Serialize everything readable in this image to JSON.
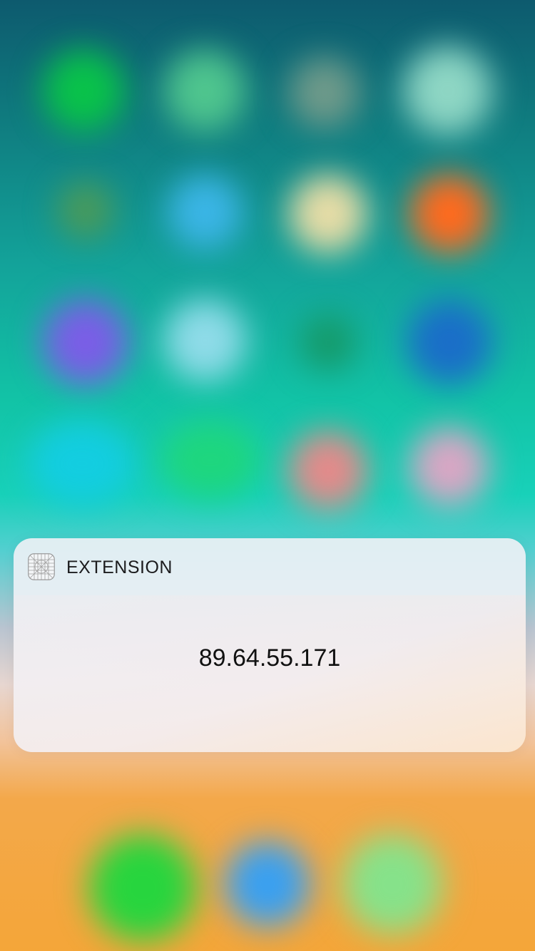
{
  "widget": {
    "app_name": "EXTENSION",
    "app_icon": "grid-box-icon",
    "value": "89.64.55.171"
  },
  "colors": {
    "wallpaper_top": "#0d5a6e",
    "wallpaper_mid": "#12c3a6",
    "wallpaper_bottom": "#f4a639",
    "widget_text": "#1c1c1e"
  }
}
